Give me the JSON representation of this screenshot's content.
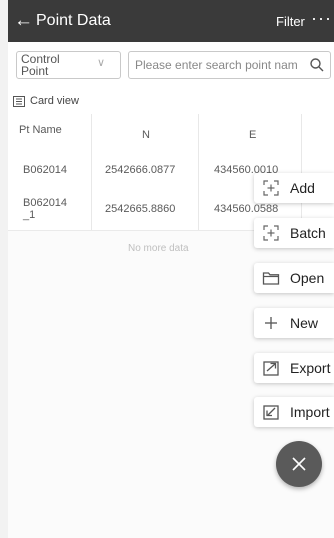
{
  "header": {
    "title": "Point Data",
    "filter_label": "Filter",
    "more_label": "···"
  },
  "filter": {
    "type_value": "Control Point",
    "search_placeholder": "Please enter search point nam"
  },
  "view": {
    "card_view_label": "Card view"
  },
  "table": {
    "columns": [
      "Pt Name",
      "N",
      "E"
    ],
    "rows": [
      {
        "name": "B062014",
        "n": "2542666.0877",
        "e": "434560.0010"
      },
      {
        "name": "B062014_1",
        "n": "2542665.8860",
        "e": "434560.0588"
      }
    ],
    "footer": "No more data"
  },
  "fab_menu": {
    "items": [
      {
        "label": "Add",
        "icon": "add-point-icon"
      },
      {
        "label": "Batch",
        "icon": "batch-icon"
      },
      {
        "label": "Open",
        "icon": "folder-icon"
      },
      {
        "label": "New",
        "icon": "plus-icon"
      },
      {
        "label": "Export",
        "icon": "export-icon"
      },
      {
        "label": "Import",
        "icon": "import-icon"
      }
    ],
    "close_icon": "close-icon"
  }
}
